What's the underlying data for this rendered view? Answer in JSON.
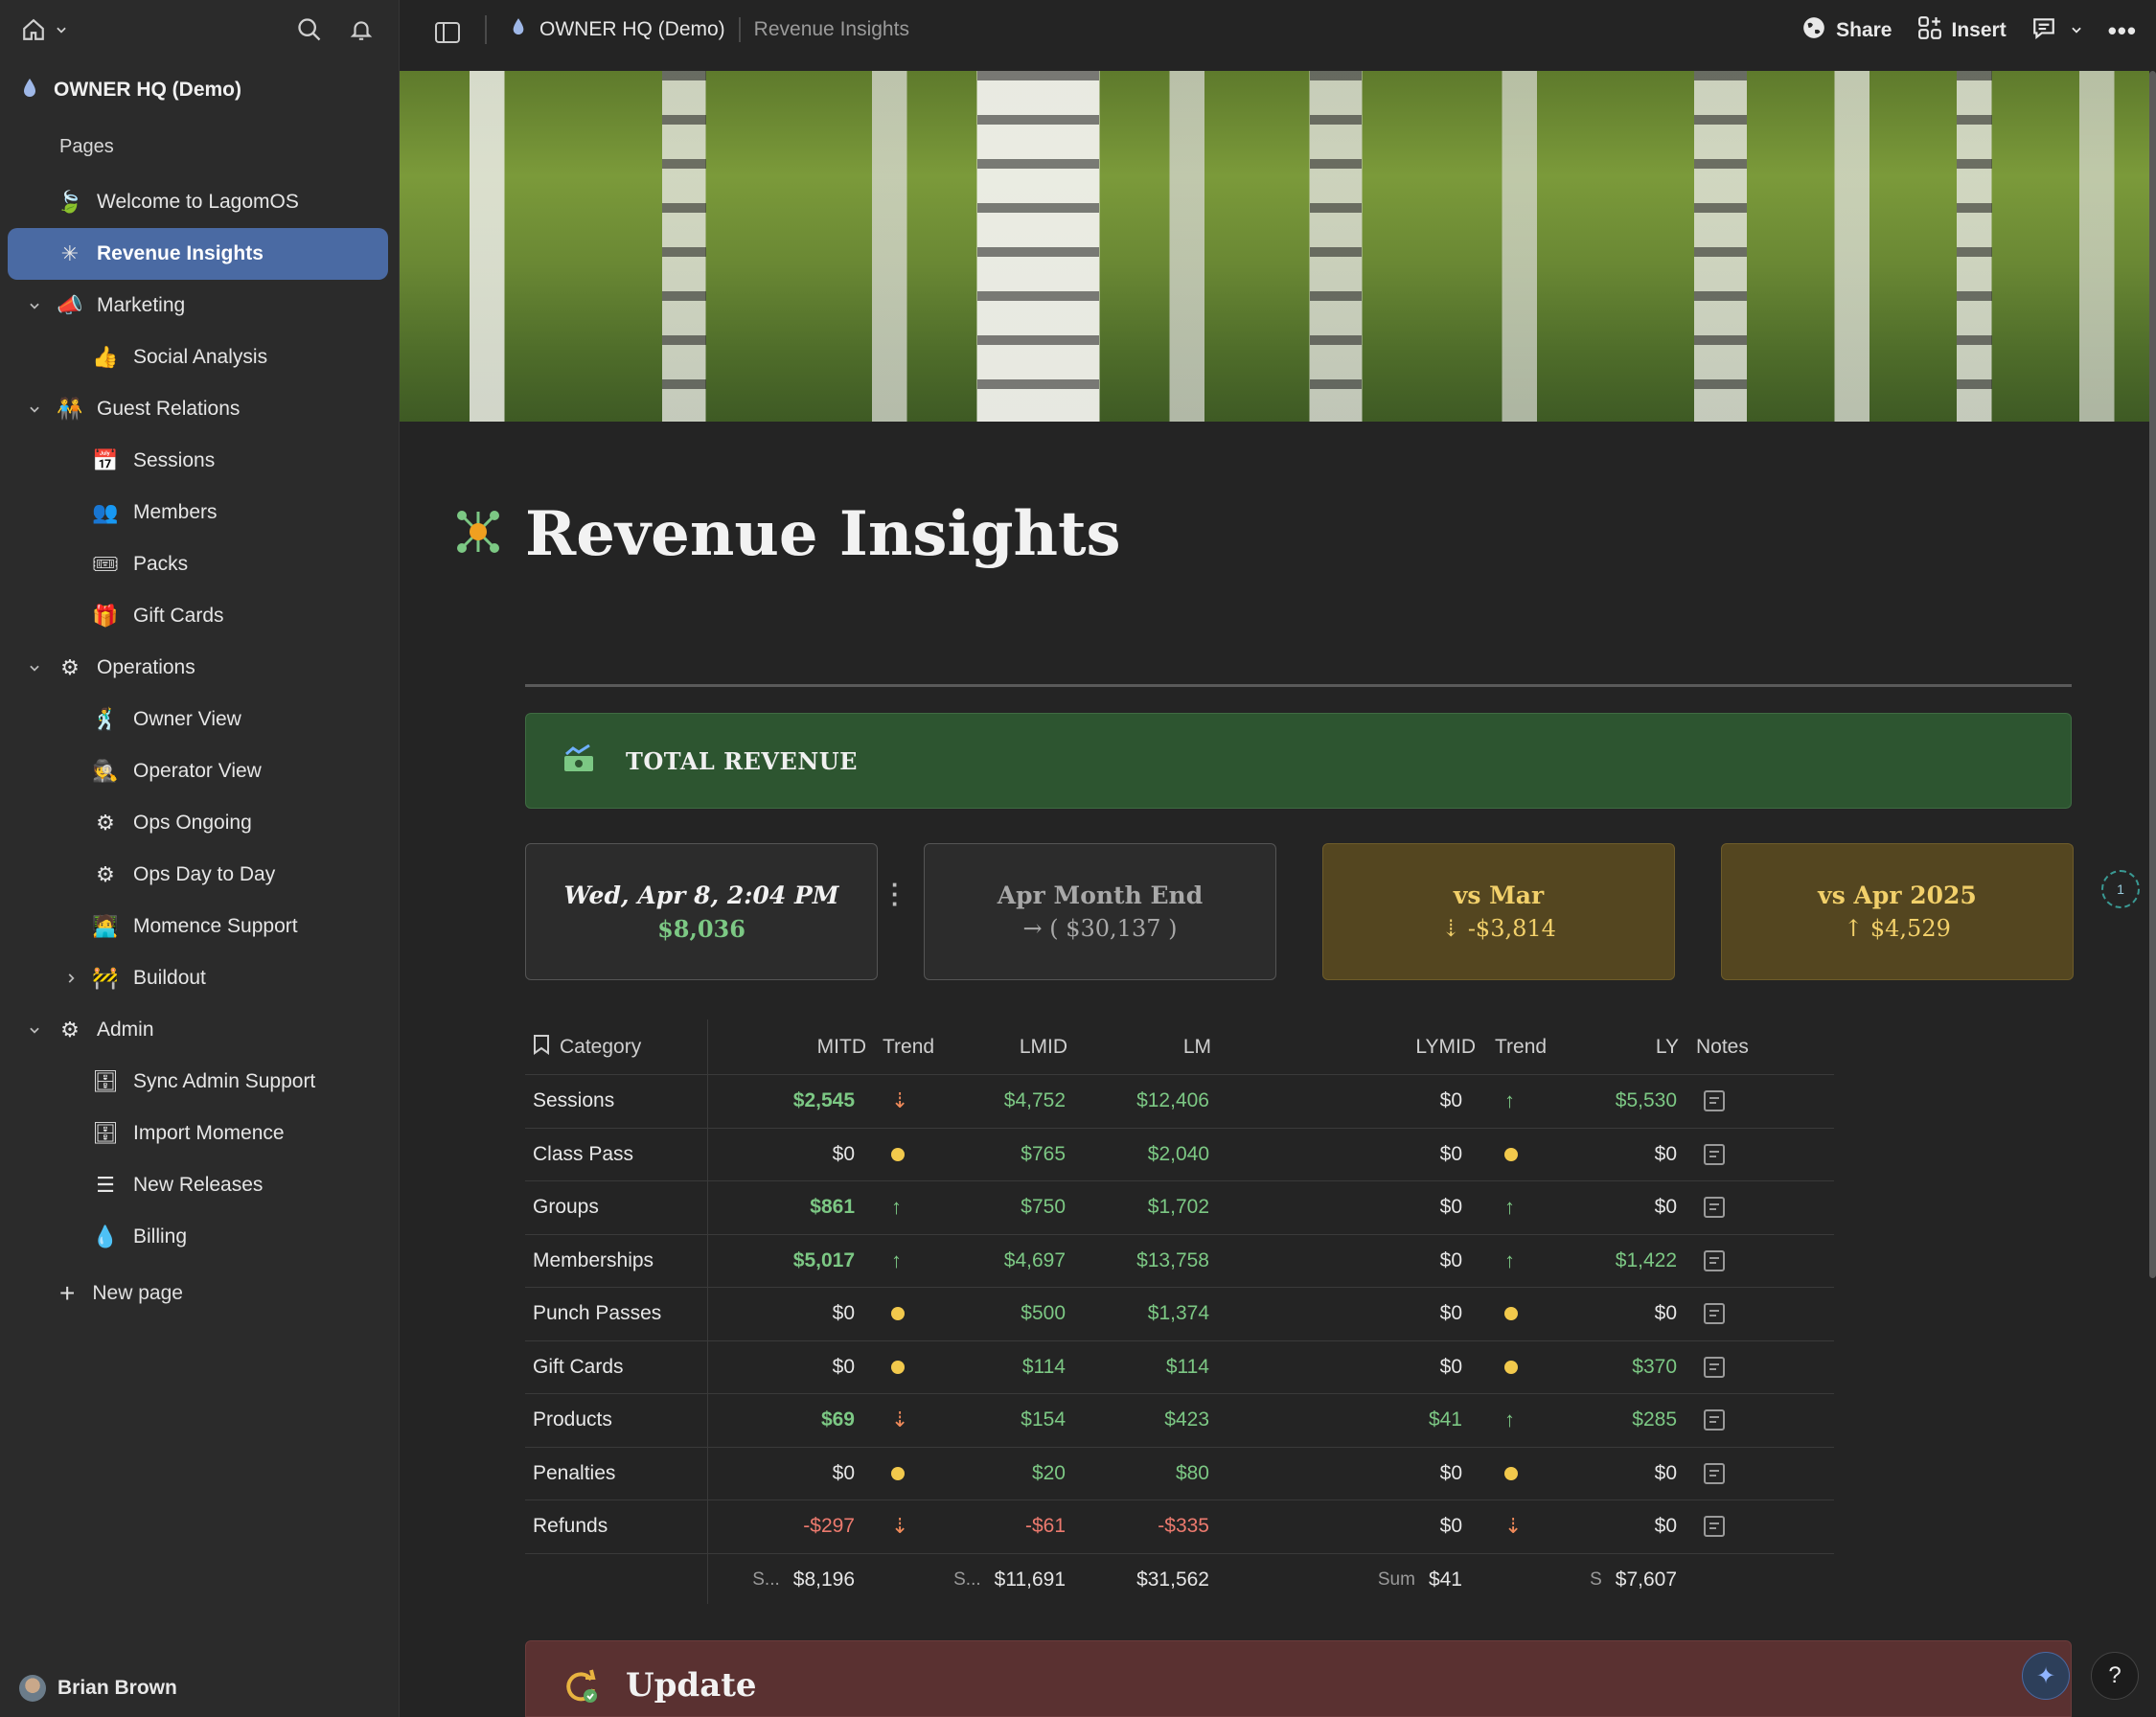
{
  "sidebar": {
    "workspace": "OWNER HQ (Demo)",
    "pages_label": "Pages",
    "items": [
      {
        "label": "Welcome to LagomOS",
        "icon": "leaf-icon",
        "glyph": "🍃",
        "level": 0,
        "chevron": ""
      },
      {
        "label": "Revenue Insights",
        "icon": "sparkle-icon",
        "glyph": "✳",
        "level": 0,
        "chevron": "",
        "active": true
      },
      {
        "label": "Marketing",
        "icon": "megaphone-icon",
        "glyph": "📣",
        "level": 0,
        "chevron": "down"
      },
      {
        "label": "Social Analysis",
        "icon": "thumbs-up-icon",
        "glyph": "👍",
        "level": 1,
        "chevron": ""
      },
      {
        "label": "Guest Relations",
        "icon": "people-icon",
        "glyph": "🧑‍🤝‍🧑",
        "level": 0,
        "chevron": "down"
      },
      {
        "label": "Sessions",
        "icon": "calendar-icon",
        "glyph": "📅",
        "level": 1,
        "chevron": ""
      },
      {
        "label": "Members",
        "icon": "members-icon",
        "glyph": "👥",
        "level": 1,
        "chevron": ""
      },
      {
        "label": "Packs",
        "icon": "packs-icon",
        "glyph": "🎟",
        "level": 1,
        "chevron": ""
      },
      {
        "label": "Gift Cards",
        "icon": "gift-card-icon",
        "glyph": "🎁",
        "level": 1,
        "chevron": ""
      },
      {
        "label": "Operations",
        "icon": "gears-icon",
        "glyph": "⚙",
        "level": 0,
        "chevron": "down"
      },
      {
        "label": "Owner View",
        "icon": "dancer-icon",
        "glyph": "🕺",
        "level": 1,
        "chevron": ""
      },
      {
        "label": "Operator View",
        "icon": "operator-icon",
        "glyph": "🕵",
        "level": 1,
        "chevron": ""
      },
      {
        "label": "Ops Ongoing",
        "icon": "gears-icon",
        "glyph": "⚙",
        "level": 1,
        "chevron": ""
      },
      {
        "label": "Ops Day to Day",
        "icon": "gears-icon",
        "glyph": "⚙",
        "level": 1,
        "chevron": ""
      },
      {
        "label": "Momence Support",
        "icon": "support-icon",
        "glyph": "🧑‍💻",
        "level": 1,
        "chevron": ""
      },
      {
        "label": "Buildout",
        "icon": "barrier-icon",
        "glyph": "🚧",
        "level": 1,
        "chevron": "right"
      },
      {
        "label": "Admin",
        "icon": "gears-icon",
        "glyph": "⚙",
        "level": 0,
        "chevron": "down"
      },
      {
        "label": "Sync Admin Support",
        "icon": "server-icon",
        "glyph": "🗄",
        "level": 1,
        "chevron": ""
      },
      {
        "label": "Import Momence",
        "icon": "server-icon",
        "glyph": "🗄",
        "level": 1,
        "chevron": ""
      },
      {
        "label": "New Releases",
        "icon": "list-icon",
        "glyph": "☰",
        "level": 1,
        "chevron": ""
      },
      {
        "label": "Billing",
        "icon": "drop-icon",
        "glyph": "💧",
        "level": 1,
        "chevron": ""
      }
    ],
    "new_page": "New page",
    "user": "Brian Brown"
  },
  "topbar": {
    "workspace": "OWNER HQ (Demo)",
    "page": "Revenue Insights",
    "share": "Share",
    "insert": "Insert"
  },
  "page": {
    "title": "Revenue Insights",
    "banner": "TOTAL REVENUE",
    "cards": [
      {
        "line1": "Wed, Apr 8, 2:04 PM",
        "line2": "$8,036",
        "style": "dark"
      },
      {
        "line1": "Apr  Month End",
        "line2": "→ (  $30,137  )",
        "style": "dark"
      },
      {
        "line1": "vs   Mar",
        "line2": "⇣   -$3,814",
        "style": "gold"
      },
      {
        "line1": "vs   Apr 2025",
        "line2": "↑    $4,529",
        "style": "gold"
      }
    ],
    "pager": "1",
    "update_title": "Update"
  },
  "table": {
    "headers": {
      "category": "Category",
      "mitd": "MITD",
      "trend": "Trend",
      "lmid": "LMID",
      "lm": "LM",
      "lymid": "LYMID",
      "trend2": "Trend",
      "ly": "LY",
      "notes": "Notes"
    },
    "rows": [
      {
        "category": "Sessions",
        "mitd": "$2,545",
        "mitd_style": "gb",
        "trend": "down",
        "lmid": "$4,752",
        "lm": "$12,406",
        "lymid": "$0",
        "lymid_style": "w",
        "trend2": "up",
        "ly": "$5,530",
        "ly_style": "g"
      },
      {
        "category": "Class Pass",
        "mitd": "$0",
        "mitd_style": "w",
        "trend": "flat",
        "lmid": "$765",
        "lm": "$2,040",
        "lymid": "$0",
        "lymid_style": "w",
        "trend2": "flat",
        "ly": "$0",
        "ly_style": "w"
      },
      {
        "category": "Groups",
        "mitd": "$861",
        "mitd_style": "gb",
        "trend": "up",
        "lmid": "$750",
        "lm": "$1,702",
        "lymid": "$0",
        "lymid_style": "w",
        "trend2": "up",
        "ly": "$0",
        "ly_style": "w"
      },
      {
        "category": "Memberships",
        "mitd": "$5,017",
        "mitd_style": "gb",
        "trend": "up",
        "lmid": "$4,697",
        "lm": "$13,758",
        "lymid": "$0",
        "lymid_style": "w",
        "trend2": "up",
        "ly": "$1,422",
        "ly_style": "g"
      },
      {
        "category": "Punch Passes",
        "mitd": "$0",
        "mitd_style": "w",
        "trend": "flat",
        "lmid": "$500",
        "lm": "$1,374",
        "lymid": "$0",
        "lymid_style": "w",
        "trend2": "flat",
        "ly": "$0",
        "ly_style": "w"
      },
      {
        "category": "Gift Cards",
        "mitd": "$0",
        "mitd_style": "w",
        "trend": "flat",
        "lmid": "$114",
        "lm": "$114",
        "lymid": "$0",
        "lymid_style": "w",
        "trend2": "flat",
        "ly": "$370",
        "ly_style": "g"
      },
      {
        "category": "Products",
        "mitd": "$69",
        "mitd_style": "gb",
        "trend": "down",
        "lmid": "$154",
        "lm": "$423",
        "lymid": "$41",
        "lymid_style": "g",
        "trend2": "up",
        "ly": "$285",
        "ly_style": "g"
      },
      {
        "category": "Penalties",
        "mitd": "$0",
        "mitd_style": "w",
        "trend": "flat",
        "lmid": "$20",
        "lm": "$80",
        "lymid": "$0",
        "lymid_style": "w",
        "trend2": "flat",
        "ly": "$0",
        "ly_style": "w"
      },
      {
        "category": "Refunds",
        "mitd": "-$297",
        "mitd_style": "rd",
        "trend": "down",
        "lmid": "-$61",
        "lmid_style": "rd",
        "lm": "-$335",
        "lm_style": "rd",
        "lymid": "$0",
        "lymid_style": "w",
        "trend2": "down",
        "ly": "$0",
        "ly_style": "w"
      }
    ],
    "footer": {
      "mitd_label": "S...",
      "mitd": "$8,196",
      "lmid_label": "S...",
      "lmid": "$11,691",
      "lm": "$31,562",
      "lymid_label": "Sum",
      "lymid": "$41",
      "ly_label": "S",
      "ly": "$7,607"
    }
  },
  "colors": {
    "accent": "#4a6aa3",
    "banner": "#2d5530",
    "gold_card": "#544620",
    "positive": "#7cc884",
    "negative": "#ec7a6e",
    "neutral_dot": "#f2c94c"
  }
}
